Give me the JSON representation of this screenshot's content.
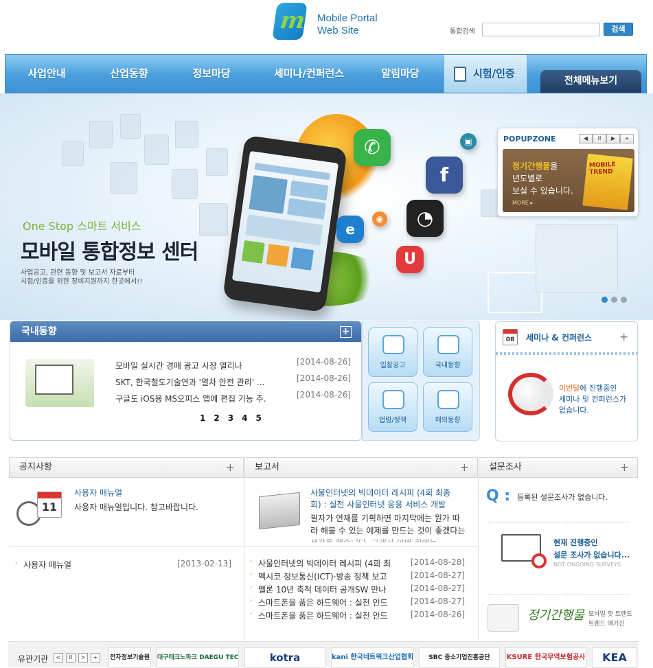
{
  "header": {
    "logo_line1": "Mobile Portal",
    "logo_line2": "Web Site",
    "search_label": "통합검색",
    "search_placeholder": "",
    "search_button": "검색"
  },
  "nav": {
    "items": [
      "사업안내",
      "산업동향",
      "정보마당",
      "세미나/컨퍼런스",
      "알림마당",
      "시험/인증"
    ],
    "all_menu": "전체메뉴보기"
  },
  "hero": {
    "subtitle": "One Stop 스마트 서비스",
    "title": "모바일 통합정보 센터",
    "desc_line1": "사업공고, 관련 동향 및 보고서 자료부터",
    "desc_line2": "시험/인증을 위한 장비지원까지 한곳에서!!"
  },
  "popup": {
    "title": "POPUPZONE",
    "controls": [
      "◀",
      "II",
      "▶",
      "+"
    ],
    "line1_highlight": "정기간행물",
    "line1_rest": "을",
    "line2": "년도별로",
    "line3": "보실 수 있습니다.",
    "more": "MORE ▸",
    "magazine": "MOBILE TREND"
  },
  "domestic": {
    "title": "국내동향",
    "rows": [
      {
        "title": "모바일 실시간 경매 광고 시장 열리나",
        "date": "[2014-08-26]"
      },
      {
        "title": "SKT, 한국철도기술연과 '열차 안전 관리' ...",
        "date": "[2014-08-26]"
      },
      {
        "title": "구글도 iOS용 MS오피스 앱에 편집 기능 추...",
        "date": "[2014-08-26]"
      }
    ],
    "pages": [
      "1",
      "2",
      "3",
      "4",
      "5"
    ]
  },
  "quick": [
    "입찰공고",
    "국내동향",
    "법령/정책",
    "해외동향"
  ],
  "seminar": {
    "title": "세미나 & 컨퍼런스",
    "cal_day": "08",
    "msg_highlight": "이번달",
    "msg_rest": "에 진행중인",
    "msg_line2": "세미나 및 컨퍼런스가",
    "msg_line3": "없습니다."
  },
  "notice": {
    "title": "공지사항",
    "feature_title": "사용자 매뉴얼",
    "feature_desc": "사용자 매뉴얼입니다. 참고바랍니다.",
    "cal_day": "11",
    "list": [
      {
        "title": "사용자 매뉴얼",
        "date": "[2013-02-13]"
      }
    ]
  },
  "report": {
    "title": "보고서",
    "feature_title1": "사물인터넷의 빅데이터 레시피 (4회 최종",
    "feature_title2": "회) : 실전 사물인터넷 응용 서비스 개발",
    "feature_desc1": "필자가 연재를 기획하면 마지막에는 뭔가 따",
    "feature_desc2": "라 해볼 수 있는 예제를 만드는 것이 좋겠다는",
    "feature_desc3": "생각을 했습니다. 그래서 이번 회에는 ...",
    "list": [
      {
        "title": "사물인터넷의 빅데이터 레시피 (4회 최",
        "date": "[2014-08-28]"
      },
      {
        "title": "멕시코 정보통신(ICT)·방송 정책 보고",
        "date": "[2014-08-27]"
      },
      {
        "title": "멜론 10년 축적 데이터 공개SW 만나",
        "date": "[2014-08-27]"
      },
      {
        "title": "스마트폰을 품은 하드웨어 : 실전 안드",
        "date": "[2014-08-27]"
      },
      {
        "title": "스마트폰을 품은 하드웨어 : 실전 안드",
        "date": "[2014-08-26]"
      }
    ]
  },
  "survey": {
    "title": "설문조사",
    "q_mark": "Q :",
    "empty": "등록된 설문조사가 없습니다.",
    "current1": "현재 진행중인",
    "current2": "설문 조사가 없습니다...",
    "current3": "NOT ONGOING SURVEYS."
  },
  "periodical": {
    "logo": "정기간행물",
    "line1": "모바일 핫 트렌드",
    "line2": "트렌드 매거진"
  },
  "related": {
    "label": "유관기관",
    "buttons": [
      "<",
      "II",
      ">",
      "+"
    ],
    "logos": [
      "전자정보기술원",
      "대구테크노파크 DAEGU TECHNOPARK",
      "kotra",
      "kani 한국네트워크산업협회",
      "SBC 중소기업진흥공단",
      "KSURE 한국무역보험공사",
      "KEA"
    ]
  },
  "colors": {
    "nav_blue": "#4a9fde",
    "nav_dark": "#203d63",
    "link_blue": "#1d5e99",
    "accent_orange": "#e86a1a",
    "hero_green": "#7cb13a"
  }
}
